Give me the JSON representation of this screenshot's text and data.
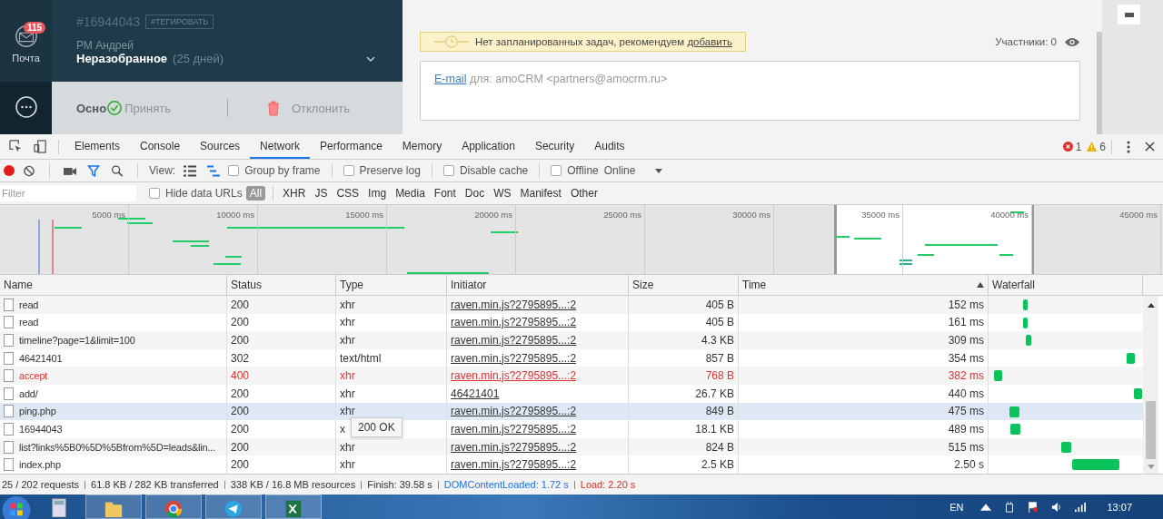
{
  "sidebar": {
    "mail": {
      "label": "Почта",
      "badge": "115"
    }
  },
  "lead": {
    "id": "#16944043",
    "tag_button": "#ТЕГИРОВАТЬ",
    "responsible": "РМ Андрей",
    "status": "Неразобранное",
    "status_age": "(25 дней)"
  },
  "lead_tabs": [
    {
      "label": "Осно",
      "selected": true
    }
  ],
  "actions": {
    "accept": "Принять",
    "reject": "Отклонить"
  },
  "notice": {
    "text": "Нет запланированных задач, рекомендуем ",
    "link": "добавить"
  },
  "participants": "Участники: 0",
  "email": {
    "link": "E-mail",
    "text": "для: amoCRM <partners@amocrm.ru>"
  },
  "devtools": {
    "tabs": [
      {
        "label": "Elements",
        "selected": false
      },
      {
        "label": "Console",
        "selected": false
      },
      {
        "label": "Sources",
        "selected": false
      },
      {
        "label": "Network",
        "selected": true
      },
      {
        "label": "Performance",
        "selected": false
      },
      {
        "label": "Memory",
        "selected": false
      },
      {
        "label": "Application",
        "selected": false
      },
      {
        "label": "Security",
        "selected": false
      },
      {
        "label": "Audits",
        "selected": false
      }
    ],
    "errors": "1",
    "warnings": "6",
    "toolbar": {
      "recording": true,
      "view_label": "View:",
      "checkboxes": [
        {
          "label": "Group by frame",
          "checked": false
        },
        {
          "label": "Preserve log",
          "checked": false
        },
        {
          "label": "Disable cache",
          "checked": false
        },
        {
          "label": "Offline",
          "checked": false
        }
      ],
      "throttle": "Online"
    },
    "filter": {
      "placeholder": "Filter",
      "hide_data_urls": {
        "label": "Hide data URLs",
        "checked": false
      },
      "types": [
        {
          "label": "All",
          "selected": true
        },
        {
          "label": "XHR",
          "selected": false
        },
        {
          "label": "JS",
          "selected": false
        },
        {
          "label": "CSS",
          "selected": false
        },
        {
          "label": "Img",
          "selected": false
        },
        {
          "label": "Media",
          "selected": false
        },
        {
          "label": "Font",
          "selected": false
        },
        {
          "label": "Doc",
          "selected": false
        },
        {
          "label": "WS",
          "selected": false
        },
        {
          "label": "Manifest",
          "selected": false
        },
        {
          "label": "Other",
          "selected": false
        }
      ]
    },
    "overview": {
      "ticks": [
        "5000 ms",
        "10000 ms",
        "15000 ms",
        "20000 ms",
        "25000 ms",
        "30000 ms",
        "35000 ms",
        "40000 ms",
        "45000 ms"
      ]
    },
    "table": {
      "columns": [
        {
          "label": "Name",
          "sorted": false
        },
        {
          "label": "Status",
          "sorted": false
        },
        {
          "label": "Type",
          "sorted": false
        },
        {
          "label": "Initiator",
          "sorted": false
        },
        {
          "label": "Size",
          "sorted": false
        },
        {
          "label": "Time",
          "sorted": true
        },
        {
          "label": "Waterfall",
          "sorted": false
        }
      ],
      "rows": [
        {
          "name": "read",
          "status": "200",
          "type": "xhr",
          "initiator": "raven.min.js?2795895...:2",
          "size": "405 B",
          "time": "152 ms",
          "error": false,
          "highlighted": false
        },
        {
          "name": "read",
          "status": "200",
          "type": "xhr",
          "initiator": "raven.min.js?2795895...:2",
          "size": "405 B",
          "time": "161 ms",
          "error": false,
          "highlighted": false
        },
        {
          "name": "timeline?page=1&limit=100",
          "status": "200",
          "type": "xhr",
          "initiator": "raven.min.js?2795895...:2",
          "size": "4.3 KB",
          "time": "309 ms",
          "error": false,
          "highlighted": false
        },
        {
          "name": "46421401",
          "status": "302",
          "type": "text/html",
          "initiator": "raven.min.js?2795895...:2",
          "size": "857 B",
          "time": "354 ms",
          "error": false,
          "highlighted": false
        },
        {
          "name": "accept",
          "status": "400",
          "type": "xhr",
          "initiator": "raven.min.js?2795895...:2",
          "size": "768 B",
          "time": "382 ms",
          "error": true,
          "highlighted": false
        },
        {
          "name": "add/",
          "status": "200",
          "type": "xhr",
          "initiator": "46421401",
          "size": "26.7 KB",
          "time": "440 ms",
          "error": false,
          "highlighted": false
        },
        {
          "name": "ping.php",
          "status": "200",
          "type": "xhr",
          "initiator": "raven.min.js?2795895...:2",
          "size": "849 B",
          "time": "475 ms",
          "error": false,
          "highlighted": true
        },
        {
          "name": "16944043",
          "status": "200",
          "type": "x",
          "initiator": "raven.min.js?2795895...:2",
          "size": "18.1 KB",
          "time": "489 ms",
          "error": false,
          "highlighted": false
        },
        {
          "name": "list?links%5B0%5D%5Bfrom%5D=leads&lin...",
          "status": "200",
          "type": "xhr",
          "initiator": "raven.min.js?2795895...:2",
          "size": "824 B",
          "time": "515 ms",
          "error": false,
          "highlighted": false
        },
        {
          "name": "index.php",
          "status": "200",
          "type": "xhr",
          "initiator": "raven.min.js?2795895...:2",
          "size": "2.5 KB",
          "time": "2.50 s",
          "error": false,
          "highlighted": false
        }
      ],
      "tooltip": "200 OK"
    },
    "status_bar": [
      {
        "text": "25 / 202 requests",
        "kind": "plain"
      },
      {
        "text": "61.8 KB / 282 KB transferred",
        "kind": "plain"
      },
      {
        "text": "338 KB / 16.8 MB resources",
        "kind": "plain"
      },
      {
        "text": "Finish: 39.58 s",
        "kind": "plain"
      },
      {
        "text": "DOMContentLoaded: 1.72 s",
        "kind": "dom"
      },
      {
        "text": "Load: 2.20 s",
        "kind": "load"
      }
    ]
  },
  "taskbar": {
    "language": "EN",
    "clock": "13:07"
  }
}
